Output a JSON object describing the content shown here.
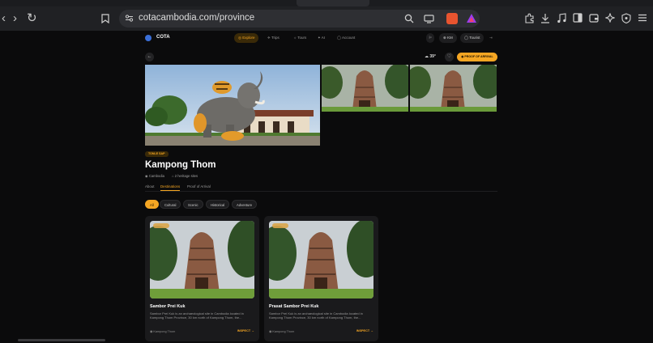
{
  "browser": {
    "url": "cotacambodia.com/province",
    "back_glyph": "‹",
    "forward_glyph": "›",
    "reload_glyph": "↻",
    "bookmark_glyph": "⌑"
  },
  "nav": {
    "brand": "COTA",
    "items": [
      "Explore",
      "Trips",
      "Tours",
      "AI",
      "Account"
    ],
    "active_index": 0,
    "lang": "KM",
    "user": "Tourist"
  },
  "toolbar": {
    "weather": "39°",
    "proof_button": "PROOF OF ARRIVAL"
  },
  "province": {
    "tag": "TONLE SAP",
    "title": "Kampong Thom",
    "country": "Cambodia",
    "heritage": "2 heritage sites"
  },
  "tabs": [
    "About",
    "Destinations",
    "Proof of Arrival"
  ],
  "active_tab": 1,
  "filters": [
    "All",
    "Cultural",
    "Scenic",
    "Historical",
    "Adventure"
  ],
  "active_filter": 0,
  "cards": [
    {
      "title": "Sambor Prei Kuk",
      "desc": "Sambor Prei Kuk is an archaeological site in Cambodia located in Kampong Thom Province, 30 km north of Kampong Thom, the...",
      "location": "Kampong Thom",
      "link": "INSPECT →"
    },
    {
      "title": "Prasat Sambor Prei Kuk",
      "desc": "Sambor Prei Kuk is an archaeological site in Cambodia located in Kampong Thom Province, 30 km north of Kampong Thom, the...",
      "location": "Kampong Thom",
      "link": "INSPECT →"
    }
  ],
  "colors": {
    "accent": "#f5a623",
    "background": "#0b0b0c",
    "card": "#1a1a1c"
  },
  "icons": [
    "search-icon",
    "cast-icon",
    "brave-shield-icon",
    "rewards-icon",
    "extensions-icon",
    "download-icon",
    "music-icon",
    "sidebar-icon",
    "wallet-icon",
    "leo-icon",
    "vpn-icon",
    "menu-icon",
    "location-icon",
    "heart-icon",
    "back-icon"
  ]
}
